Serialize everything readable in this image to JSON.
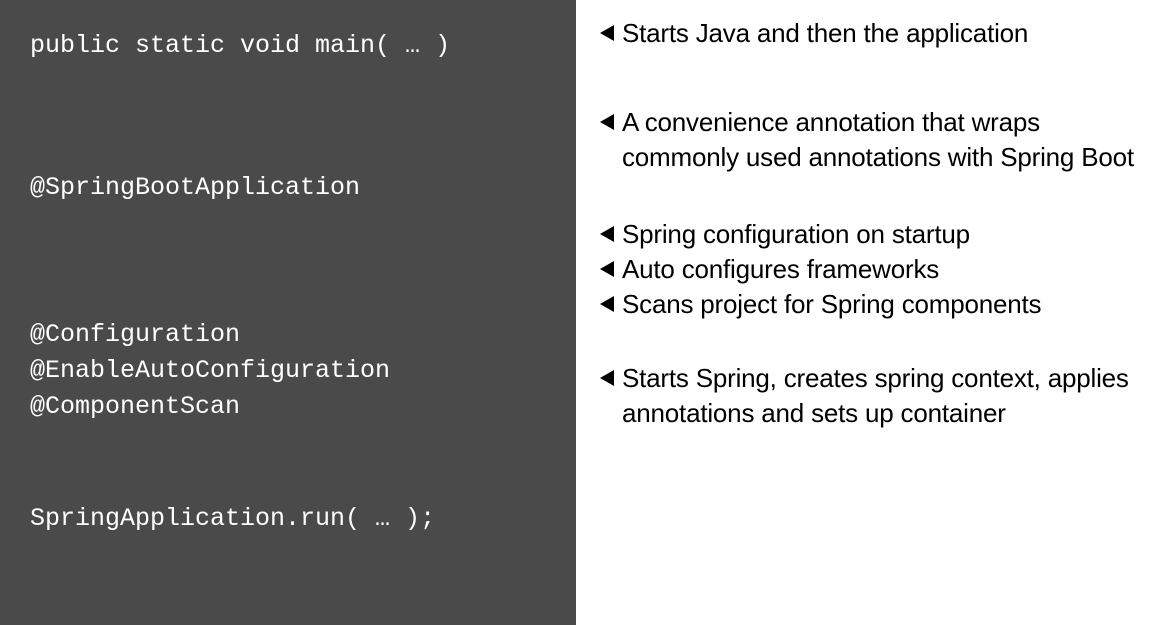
{
  "code": {
    "line1": "public static void main( … )",
    "line2": "@SpringBootApplication",
    "line3": "@Configuration",
    "line4": "@EnableAutoConfiguration",
    "line5": "@ComponentScan",
    "line6": "SpringApplication.run( … );"
  },
  "desc": {
    "item1": "Starts Java and then the application",
    "item2": "A convenience annotation that wraps commonly used annotations with Spring Boot",
    "item3": "Spring configuration on startup",
    "item4": "Auto configures frameworks",
    "item5": "Scans project for Spring components",
    "item6": "Starts Spring, creates spring context, applies annotations and sets up container"
  }
}
